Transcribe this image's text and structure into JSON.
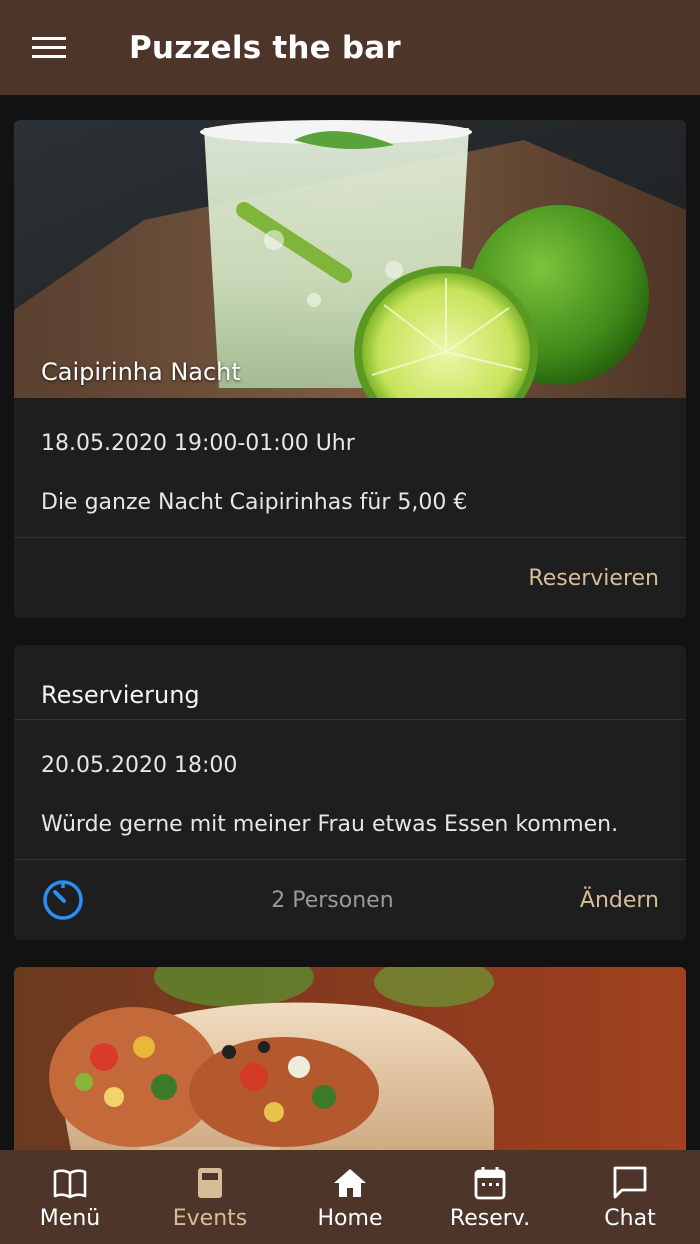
{
  "app": {
    "title": "Puzzels the bar"
  },
  "colors": {
    "appbar": "#4e352a",
    "background": "#121212",
    "card": "#1e1e1e",
    "accent": "#d6bd98",
    "timer": "#2b8ef0"
  },
  "event_card": {
    "image": "caipirinha-lime-photo",
    "title": "Caipirinha Nacht",
    "date": "18.05.2020 19:00-01:00 Uhr",
    "description": "Die ganze Nacht Caipirinhas für 5,00 €",
    "action_label": "Reservieren"
  },
  "reservation_card": {
    "heading": "Reservierung",
    "date": "20.05.2020 18:00",
    "note": "Würde gerne mit meiner Frau etwas Essen kommen.",
    "status_icon": "timer-icon",
    "persons": "2 Personen",
    "action_label": "Ändern"
  },
  "next_card": {
    "image": "burrito-photo"
  },
  "nav": {
    "items": [
      {
        "label": "Menü",
        "icon": "book-icon"
      },
      {
        "label": "Events",
        "icon": "event-icon",
        "active": true
      },
      {
        "label": "Home",
        "icon": "home-icon"
      },
      {
        "label": "Reserv.",
        "icon": "calendar-icon"
      },
      {
        "label": "Chat",
        "icon": "chat-icon"
      }
    ]
  }
}
